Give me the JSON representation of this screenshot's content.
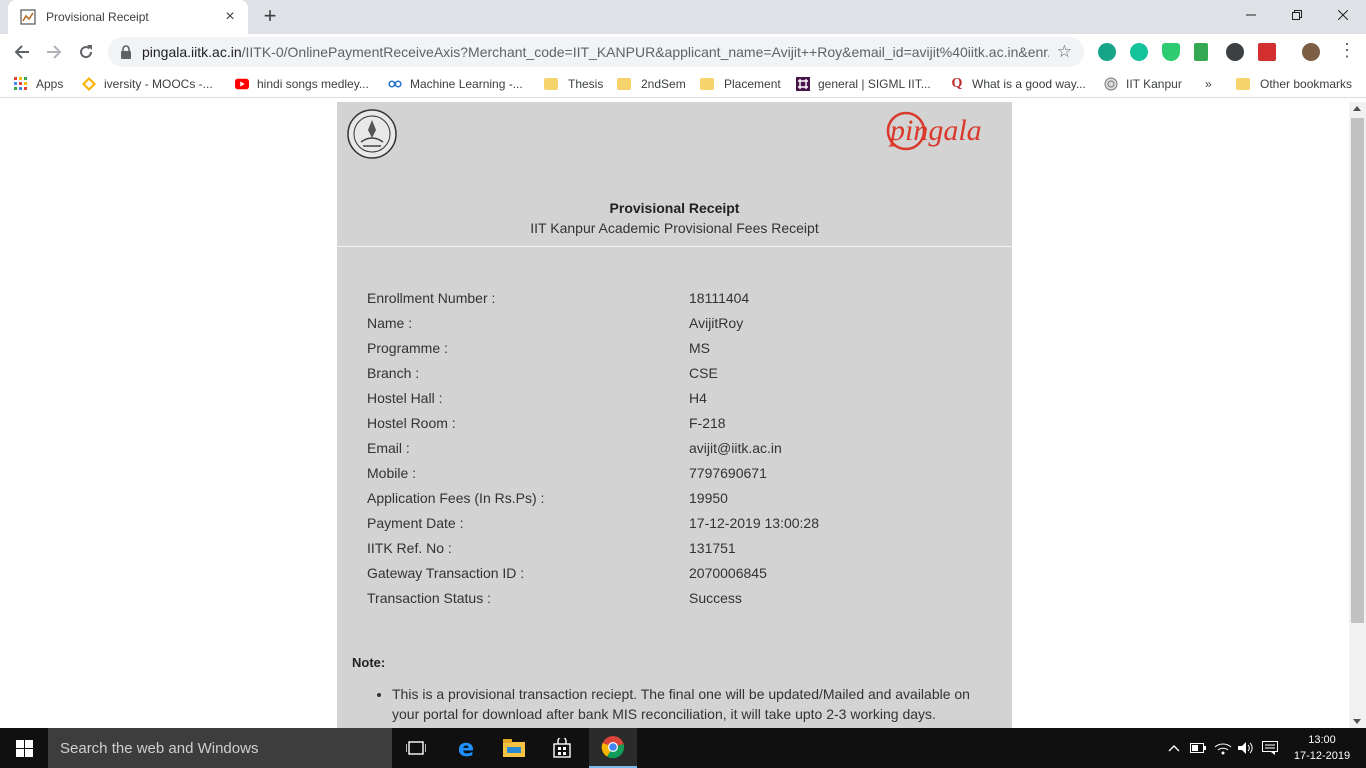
{
  "browser": {
    "tab_title": "Provisional Receipt",
    "tab_close": "×",
    "new_tab": "+",
    "url_host": "pingala.iitk.ac.in",
    "url_path": "/IITK-0/OnlinePaymentReceiveAxis?Merchant_code=IIT_KANPUR&applicant_name=Avijit++Roy&email_id=avijit%40iitk.ac.in&enr...",
    "star": "☆",
    "menu": "⋮"
  },
  "bookmarks": [
    {
      "label": "Apps",
      "icon": "apps-grid-icon"
    },
    {
      "label": "iversity - MOOCs -...",
      "icon": "iversity-icon"
    },
    {
      "label": "hindi songs medley...",
      "icon": "youtube-icon"
    },
    {
      "label": "Machine Learning -...",
      "icon": "coursera-icon"
    },
    {
      "label": "Thesis",
      "icon": "folder-icon"
    },
    {
      "label": "2ndSem",
      "icon": "folder-icon"
    },
    {
      "label": "Placement",
      "icon": "folder-icon"
    },
    {
      "label": "general | SIGML IIT...",
      "icon": "slack-icon"
    },
    {
      "label": "What is a good way...",
      "icon": "quora-icon"
    },
    {
      "label": "IIT Kanpur",
      "icon": "iitk-icon"
    },
    {
      "label": "»",
      "icon": ""
    },
    {
      "label": "Other bookmarks",
      "icon": "folder-icon"
    }
  ],
  "receipt": {
    "brand": "pingala",
    "title": "Provisional Receipt",
    "subtitle": "IIT Kanpur Academic Provisional Fees Receipt",
    "rows": [
      {
        "label": "Enrollment Number :",
        "value": "18111404"
      },
      {
        "label": "Name :",
        "value": "AvijitRoy"
      },
      {
        "label": "Programme :",
        "value": "MS"
      },
      {
        "label": "Branch :",
        "value": "CSE"
      },
      {
        "label": "Hostel Hall :",
        "value": "H4"
      },
      {
        "label": "Hostel Room :",
        "value": "F-218"
      },
      {
        "label": "Email :",
        "value": "avijit@iitk.ac.in"
      },
      {
        "label": "Mobile :",
        "value": "7797690671"
      },
      {
        "label": "Application Fees (In Rs.Ps) :",
        "value": "19950"
      },
      {
        "label": "Payment Date :",
        "value": "17-12-2019 13:00:28"
      },
      {
        "label": "IITK Ref. No :",
        "value": "131751"
      },
      {
        "label": "Gateway Transaction ID :",
        "value": "2070006845"
      },
      {
        "label": "Transaction Status :",
        "value": "Success"
      }
    ],
    "note_title": "Note:",
    "notes": [
      "This is a provisional transaction reciept. The final one will be updated/Mailed and available on your portal for download after bank MIS reconciliation, it will take upto 2-3 working days."
    ]
  },
  "taskbar": {
    "search_placeholder": "Search the web and Windows",
    "time": "13:00",
    "date": "17-12-2019"
  },
  "colors": {
    "brand_red": "#d9382b",
    "receipt_bg": "#d3d3d3",
    "chrome_bg": "#dee1e6"
  }
}
